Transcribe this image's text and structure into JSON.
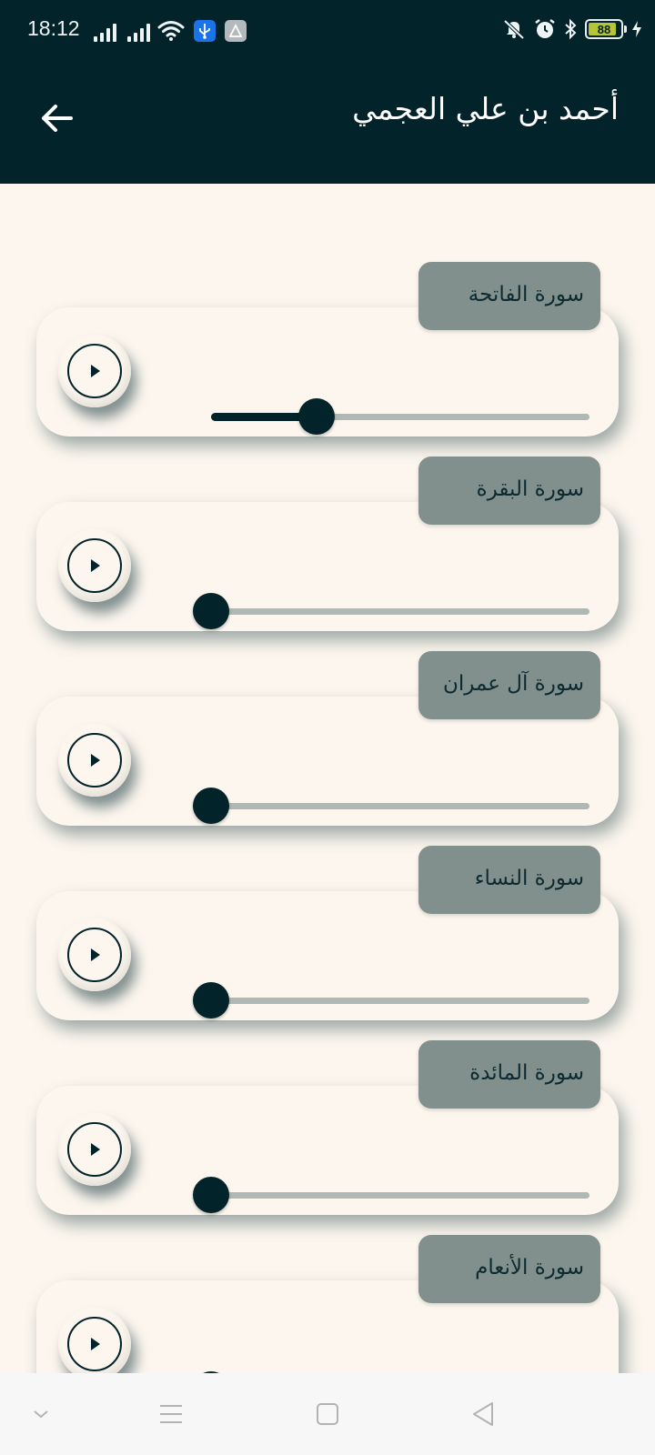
{
  "status_bar": {
    "time": "18:12",
    "battery_level": "88",
    "icons": [
      "signal-icon",
      "signal-icon",
      "wifi-icon",
      "usb-icon",
      "app-notification-icon",
      "mute-icon",
      "alarm-icon",
      "bluetooth-icon",
      "battery-icon",
      "charging-icon"
    ]
  },
  "app_bar": {
    "title": "أحمد بن علي العجمي",
    "back_icon": "arrow-left-icon"
  },
  "colors": {
    "header_bg": "#02232a",
    "page_bg": "#fcf6ee",
    "tag_bg": "#81908d",
    "accent": "#02232a",
    "track": "#aeb8b4"
  },
  "surahs": [
    {
      "name": "سورة الفاتحة",
      "progress": 0.28
    },
    {
      "name": "سورة البقرة",
      "progress": 0
    },
    {
      "name": "سورة آل عمران",
      "progress": 0
    },
    {
      "name": "سورة النساء",
      "progress": 0
    },
    {
      "name": "سورة المائدة",
      "progress": 0
    },
    {
      "name": "سورة الأنعام",
      "progress": 0
    }
  ],
  "nav_bar": {
    "icons": [
      "chevron-down-icon",
      "menu-icon",
      "home-square-icon",
      "back-triangle-icon"
    ]
  }
}
